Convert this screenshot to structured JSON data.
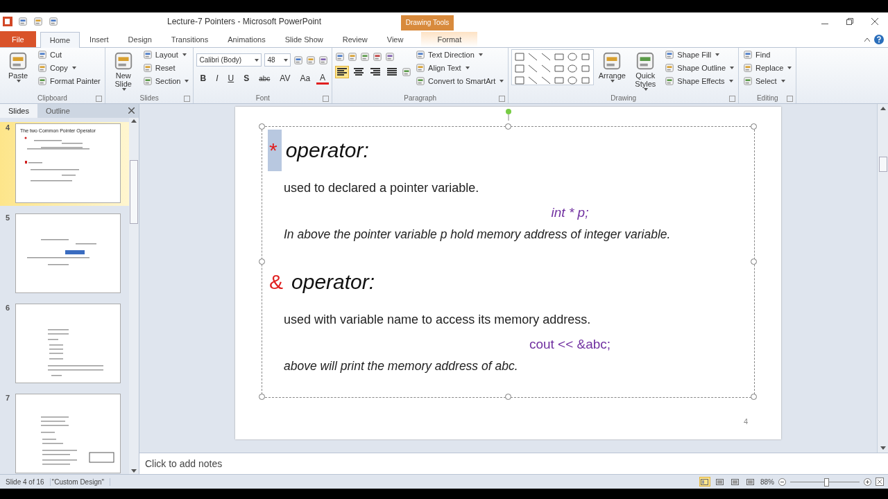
{
  "window": {
    "title": "Lecture-7 Pointers  -  Microsoft PowerPoint",
    "context_group": "Drawing Tools"
  },
  "tabs": [
    {
      "label": "File",
      "kind": "file",
      "selected": false
    },
    {
      "label": "Home",
      "kind": "normal",
      "selected": true
    },
    {
      "label": "Insert",
      "kind": "normal",
      "selected": false
    },
    {
      "label": "Design",
      "kind": "normal",
      "selected": false
    },
    {
      "label": "Transitions",
      "kind": "normal",
      "selected": false
    },
    {
      "label": "Animations",
      "kind": "normal",
      "selected": false
    },
    {
      "label": "Slide Show",
      "kind": "normal",
      "selected": false
    },
    {
      "label": "Review",
      "kind": "normal",
      "selected": false
    },
    {
      "label": "View",
      "kind": "normal",
      "selected": false
    },
    {
      "label": "Format",
      "kind": "contextual",
      "selected": false
    }
  ],
  "ribbon": {
    "groups": [
      {
        "label": "Clipboard",
        "kind": "standard",
        "large": [
          {
            "label": "Paste",
            "dropdown": true
          }
        ],
        "small": [
          {
            "label": "Cut",
            "dropdown": false
          },
          {
            "label": "Copy",
            "dropdown": true
          },
          {
            "label": "Format Painter",
            "dropdown": false
          }
        ]
      },
      {
        "label": "Slides",
        "kind": "standard",
        "large": [
          {
            "label": "New Slide",
            "dropdown": true
          }
        ],
        "small": [
          {
            "label": "Layout",
            "dropdown": true
          },
          {
            "label": "Reset",
            "dropdown": false
          },
          {
            "label": "Section",
            "dropdown": true
          }
        ]
      },
      {
        "label": "Font",
        "kind": "font",
        "font_name": "Calibri (Body)",
        "font_size": "48",
        "format_buttons": [
          {
            "label": "B"
          },
          {
            "label": "I"
          },
          {
            "label": "U"
          },
          {
            "label": "S"
          },
          {
            "label": "abc"
          },
          {
            "label": "AV"
          },
          {
            "label": "Aa"
          },
          {
            "label": "A"
          }
        ]
      },
      {
        "label": "Paragraph",
        "kind": "paragraph",
        "alignment": [
          {
            "selected": true
          },
          {
            "selected": false
          },
          {
            "selected": false
          },
          {
            "selected": false
          }
        ],
        "small": [
          {
            "label": "Text Direction",
            "dropdown": true
          },
          {
            "label": "Align Text",
            "dropdown": true
          },
          {
            "label": "Convert to SmartArt",
            "dropdown": true
          }
        ]
      },
      {
        "label": "Drawing",
        "kind": "drawing",
        "large": [
          {
            "label": "Arrange",
            "dropdown": true
          },
          {
            "label": "Quick Styles",
            "dropdown": true
          }
        ],
        "small": [
          {
            "label": "Shape Fill",
            "dropdown": true
          },
          {
            "label": "Shape Outline",
            "dropdown": true
          },
          {
            "label": "Shape Effects",
            "dropdown": true
          }
        ]
      },
      {
        "label": "Editing",
        "kind": "standard",
        "small": [
          {
            "label": "Find",
            "dropdown": false
          },
          {
            "label": "Replace",
            "dropdown": true
          },
          {
            "label": "Select",
            "dropdown": true
          }
        ]
      }
    ]
  },
  "slides_panel": {
    "tabs": [
      {
        "label": "Slides",
        "selected": true
      },
      {
        "label": "Outline",
        "selected": false
      }
    ],
    "thumbnails": [
      {
        "number": "4",
        "selected": true,
        "title": "The two Common Pointer Operator"
      },
      {
        "number": "5",
        "selected": false
      },
      {
        "number": "6",
        "selected": false
      },
      {
        "number": "7",
        "selected": false
      }
    ]
  },
  "slide": {
    "page_number": "4",
    "content": [
      {
        "kind": "heading",
        "symbol": "*",
        "symbol_highlighted": true,
        "text": "operator:"
      },
      {
        "kind": "body",
        "text": "used to declared a pointer variable."
      },
      {
        "kind": "code",
        "italic": true,
        "text": "int * p;"
      },
      {
        "kind": "note",
        "text": "In above the pointer variable p hold memory address of integer variable."
      },
      {
        "kind": "heading",
        "symbol": "&",
        "symbol_highlighted": false,
        "text": "operator:"
      },
      {
        "kind": "body",
        "text": "used with variable name to access its memory address."
      },
      {
        "kind": "code",
        "italic": false,
        "text": "cout << &abc;"
      },
      {
        "kind": "note",
        "text": "above will print the memory address of abc."
      }
    ]
  },
  "notes": {
    "placeholder": "Click to add notes"
  },
  "status_bar": {
    "slide_info": "Slide 4 of 16",
    "theme": "\"Custom Design\"",
    "views": [
      {
        "selected": true
      },
      {
        "selected": false
      },
      {
        "selected": false
      },
      {
        "selected": false
      }
    ],
    "zoom": "88%",
    "zoom_slider": {
      "level": 0.52
    }
  }
}
